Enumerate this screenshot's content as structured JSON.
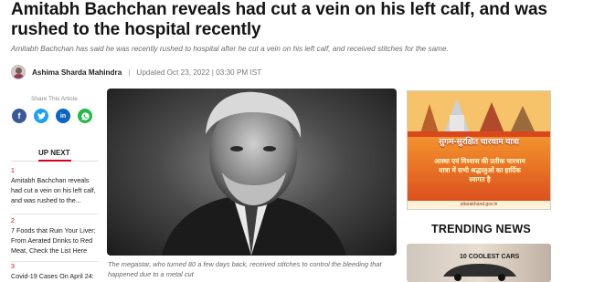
{
  "article": {
    "headline": "Amitabh Bachchan reveals had cut a vein on his left calf, and was rushed to the hospital recently",
    "summary": "Amitabh Bachchan has said he was recently rushed to hospital after he cut a vein on his left calf, and received stitches for the same.",
    "author": "Ashima Sharda Mahindra",
    "separator": "|",
    "updated": "Updated Oct 23, 2022 | 03:30 PM IST",
    "image_caption": "The megastar, who turned 80 a few days back, received stitches to control the bleeding that happened due to a metal cut"
  },
  "share": {
    "label": "Share This Article",
    "buttons": [
      {
        "name": "facebook",
        "glyph": "f",
        "color": "#3b5998"
      },
      {
        "name": "twitter",
        "glyph": "t",
        "color": "#1da1f2"
      },
      {
        "name": "linkedin",
        "glyph": "in",
        "color": "#0a66c2"
      },
      {
        "name": "whatsapp",
        "glyph": "w",
        "color": "#25b84a"
      }
    ]
  },
  "up_next": {
    "title": "UP NEXT",
    "items": [
      {
        "num": "1",
        "text": "Amitabh Bachchan reveals had cut a vein on his left calf, and was rushed to the..."
      },
      {
        "num": "2",
        "text": "7 Foods that Ruin Your Liver; From Aerated Drinks to Red Meat, Check the List Here"
      },
      {
        "num": "3",
        "text": "Covid-19 Cases On April 24: Another Dip In Count, India..."
      }
    ]
  },
  "ad": {
    "title": "सुगम-सुरक्षित चारधाम यात्रा",
    "body": "आस्था एवं विश्वास की प्रतीक चारधाम यात्रा में सभी श्रद्धालुओं का हार्दिक स्वागत है",
    "footer": "uttarakhand.gov.in"
  },
  "trending": {
    "title": "TRENDING NEWS",
    "card_text": "10 COOLEST CARS"
  },
  "colors": {
    "accent_red": "#d7001e",
    "ad_orange": "#f08b2b"
  }
}
